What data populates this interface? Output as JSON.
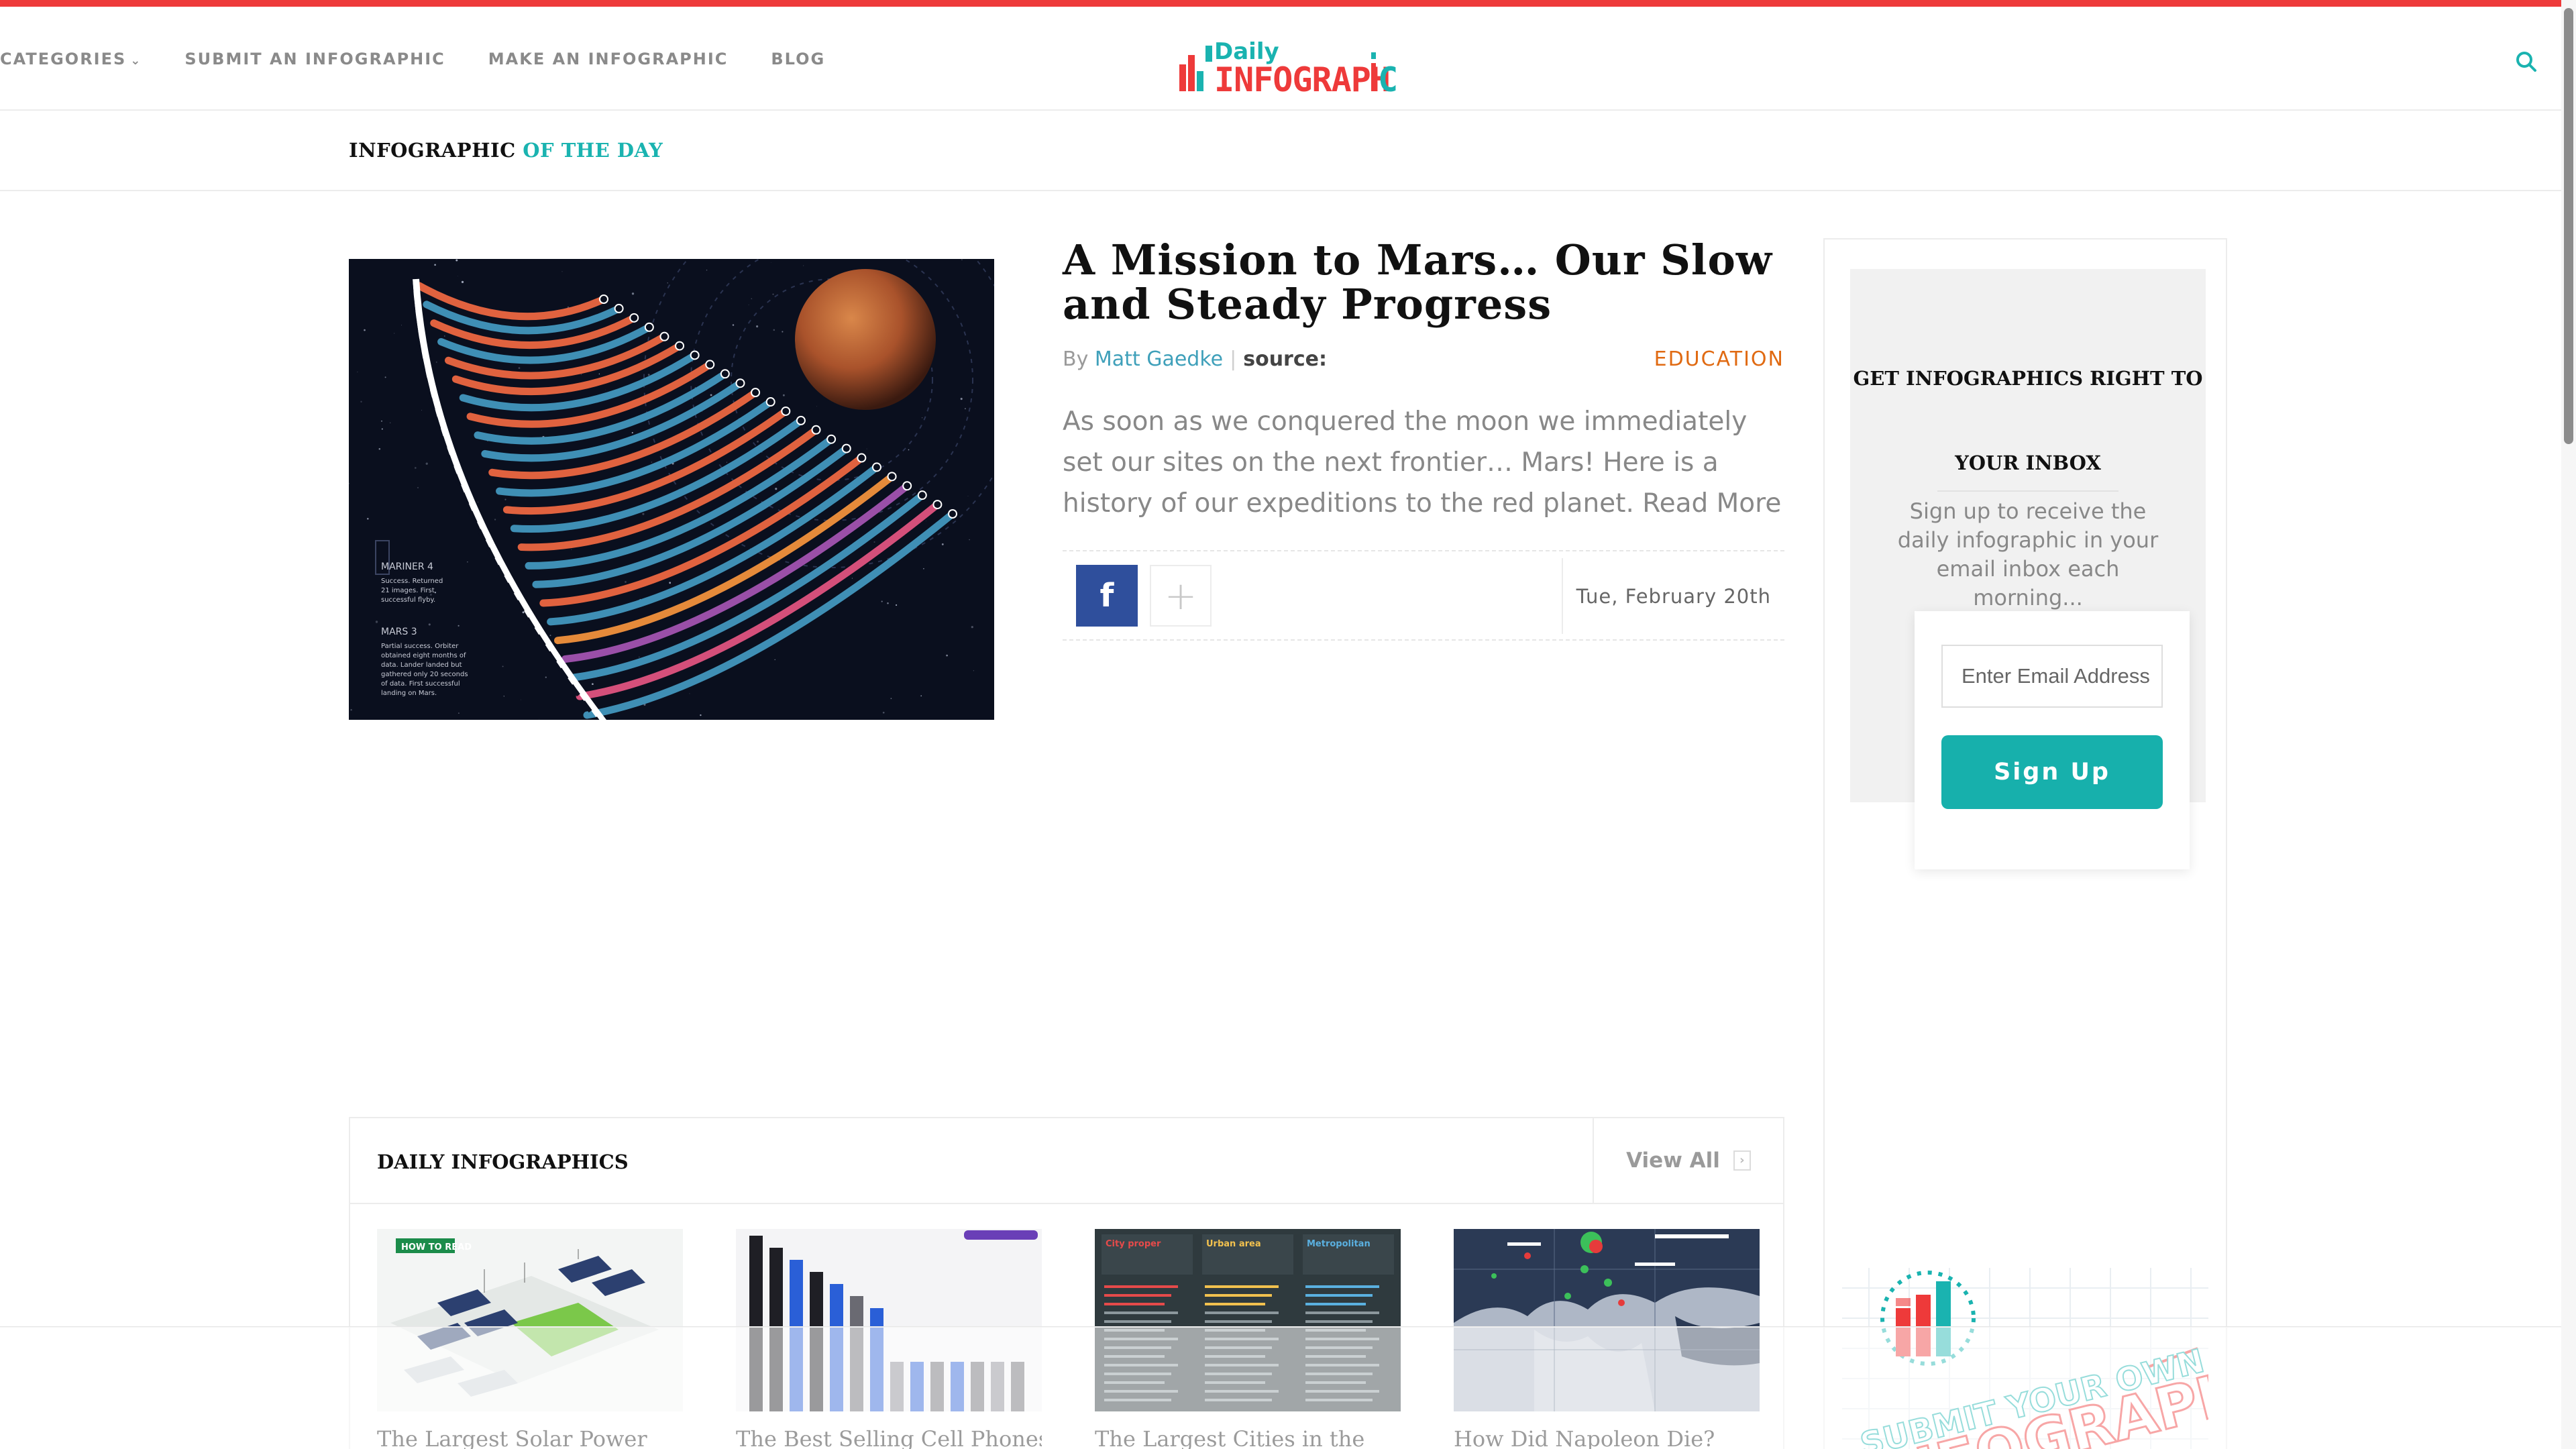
{
  "brand": {
    "logo_small": "Daily",
    "logo_big": "INFOGRAPHIC",
    "red": "#ee3a3a",
    "teal": "#1ab3b0",
    "orange": "#e06a12"
  },
  "nav": {
    "items": [
      {
        "label": "CATEGORIES",
        "icon": "chevron-down-icon"
      },
      {
        "label": "SUBMIT AN INFOGRAPHIC"
      },
      {
        "label": "MAKE AN INFOGRAPHIC"
      },
      {
        "label": "BLOG"
      }
    ],
    "search_icon": "search-icon"
  },
  "iotd": {
    "label_main": "INFOGRAPHIC",
    "label_accent": "OF THE DAY"
  },
  "post": {
    "title": "A Mission to Mars… Our Slow and Steady Progress",
    "by": "By",
    "author": "Matt Gaedke",
    "separator": "|",
    "source_label": "source:",
    "category": "EDUCATION",
    "excerpt": "As soon as we conquered the moon we immediately set our sites on the next frontier… Mars! Here is a history of our expeditions to the red planet. Read More",
    "date": "Tue, February 20th",
    "share": {
      "facebook_label": "f",
      "more_label": "+"
    },
    "image_labels": {
      "mariner4_title": "MARINER 4",
      "mariner4_text": "Success. Returned 21 images. First successful flyby.",
      "mars3_title": "MARS 3",
      "mars3_text": "Partial success. Orbiter obtained eight months of data. Lander landed but gathered only 20 seconds of data. First successful landing on Mars."
    }
  },
  "newsletter": {
    "title": "GET INFOGRAPHICS RIGHT TO YOUR INBOX",
    "description": "Sign up to receive the daily infographic in your email inbox each morning...",
    "email_placeholder": "Enter Email Address",
    "button_label": "Sign Up"
  },
  "daily": {
    "title": "DAILY INFOGRAPHICS",
    "view_all": "View All",
    "cards": [
      {
        "title": "The Largest Solar Power",
        "thumb_label": "HOW TO READ"
      },
      {
        "title": "The Best Selling Cell Phones",
        "thumb_label": ""
      },
      {
        "title": "The Largest Cities in the",
        "thumb_label": ""
      },
      {
        "title": "How Did Napoleon Die?",
        "thumb_label": ""
      }
    ],
    "card2_columns": [
      "City proper",
      "Urban area",
      "Metropolitan"
    ]
  },
  "promo": {
    "line1": "SUBMIT YOUR OWN",
    "line2": "INFOGRAPHICS"
  }
}
